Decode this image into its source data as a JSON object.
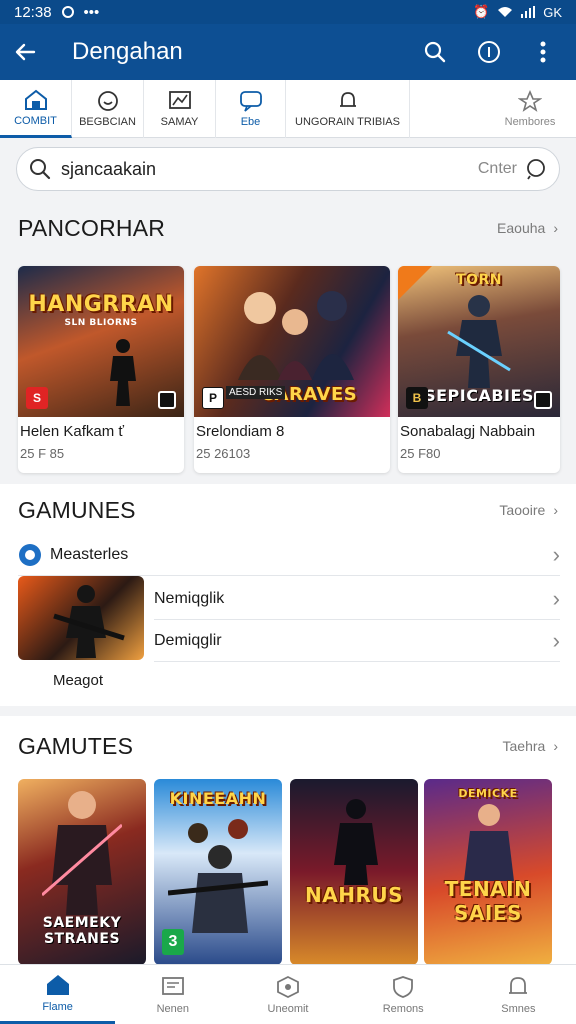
{
  "status_bar": {
    "time": "12:38",
    "signal": "ᗑ",
    "battery": "GK"
  },
  "app_bar": {
    "title": "Dengahan"
  },
  "tabs": [
    {
      "label": "COMBIT"
    },
    {
      "label": "BEGBCIAN"
    },
    {
      "label": "SAMAY"
    },
    {
      "label": "Ebe"
    },
    {
      "label": "UNGORAIN TRIBIAS"
    },
    {
      "label": "Nembores"
    }
  ],
  "search": {
    "value": "sjancaakain",
    "hint": "Cnter"
  },
  "section1": {
    "title": "PANCORHAR",
    "more": "Eaouha",
    "cards": [
      {
        "name": "Helen Kafkam ť",
        "meta": "25 F 85",
        "art_title": "HANGRRAN",
        "art_sub": "SLN BLIORNS",
        "badge": "S"
      },
      {
        "name": "Srelondiam 8",
        "meta": "25 26103",
        "art_title": "CARAVES",
        "art_sub": "AESD RIKS",
        "badge": "P"
      },
      {
        "name": "Sonabalagj Nabbain",
        "meta": "25 F80",
        "art_title": "SEPICABIES",
        "art_sub": "TORN",
        "badge": "B"
      }
    ]
  },
  "section2": {
    "title": "GAMUNES",
    "more": "Taooire",
    "header_row": "Measterles",
    "thumb_caption": "Meagot",
    "rows": [
      "Nemiqglik",
      "Demiqglir"
    ]
  },
  "section3": {
    "title": "GAMUTES",
    "more": "Taehra",
    "posters": [
      {
        "art_title": "SAEMEKY STRANES"
      },
      {
        "art_title": "KINEEAHN",
        "badge": "3"
      },
      {
        "art_title": "NAHRUS"
      },
      {
        "art_title": "TENAIN SAIES",
        "top": "DEMICKE"
      }
    ]
  },
  "bottom_nav": [
    {
      "label": "Flame"
    },
    {
      "label": "Nenen"
    },
    {
      "label": "Uneomit"
    },
    {
      "label": "Remons"
    },
    {
      "label": "Smnes"
    }
  ],
  "colors": {
    "primary": "#0d4f93",
    "accent": "#0d5ca8",
    "bg": "#f2f3f5"
  }
}
